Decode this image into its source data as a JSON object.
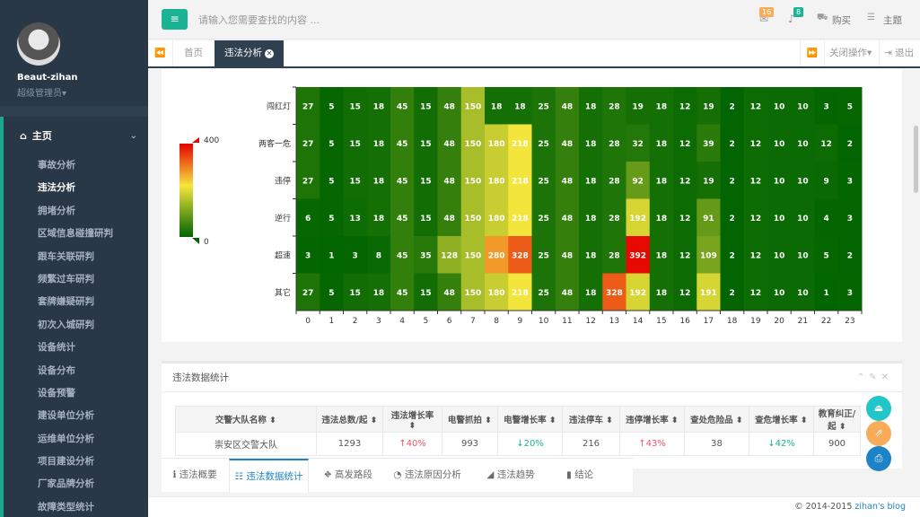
{
  "sidebar": {
    "user_name": "Beaut-zihan",
    "user_role": "超级管理员",
    "menu_title": "主页",
    "items": [
      {
        "label": "事故分析"
      },
      {
        "label": "违法分析",
        "active": true
      },
      {
        "label": "拥堵分析"
      },
      {
        "label": "区域信息碰撞研判"
      },
      {
        "label": "跟车关联研判"
      },
      {
        "label": "频繁过车研判"
      },
      {
        "label": "套牌嫌疑研判"
      },
      {
        "label": "初次入城研判"
      },
      {
        "label": "设备统计"
      },
      {
        "label": "设备分布"
      },
      {
        "label": "设备预警"
      },
      {
        "label": "建设单位分析"
      },
      {
        "label": "运维单位分析"
      },
      {
        "label": "项目建设分析"
      },
      {
        "label": "厂家品牌分析"
      },
      {
        "label": "故障类型统计"
      }
    ]
  },
  "topbar": {
    "search_placeholder": "请输入您需要查找的内容 ...",
    "mail_count": "16",
    "bell_count": "8",
    "buy_label": "购买",
    "theme_label": "主题",
    "colors": {
      "mail_badge": "#f8ac59",
      "bell_badge": "#1ab394"
    }
  },
  "tabs": {
    "home": "首页",
    "active": "违法分析",
    "close_ops": "关闭操作",
    "logout": "退出"
  },
  "heatmap": {
    "legend_max": "400",
    "legend_min": "0",
    "colors": {
      "low": "#006400",
      "mid": "#f5e63c",
      "high": "#e60000"
    }
  },
  "chart_data": {
    "type": "heatmap",
    "x": [
      "0",
      "1",
      "2",
      "3",
      "4",
      "5",
      "6",
      "7",
      "8",
      "9",
      "10",
      "11",
      "12",
      "13",
      "14",
      "15",
      "16",
      "17",
      "18",
      "19",
      "20",
      "21",
      "22",
      "23"
    ],
    "y": [
      "闯红灯",
      "两客一危",
      "违停",
      "逆行",
      "超速",
      "其它"
    ],
    "values": [
      [
        27,
        5,
        15,
        18,
        45,
        15,
        48,
        150,
        18,
        18,
        25,
        48,
        18,
        28,
        19,
        18,
        12,
        19,
        2,
        12,
        10,
        10,
        3,
        5
      ],
      [
        27,
        5,
        15,
        18,
        45,
        15,
        48,
        150,
        180,
        218,
        25,
        48,
        18,
        28,
        32,
        18,
        12,
        39,
        2,
        12,
        10,
        10,
        12,
        2
      ],
      [
        27,
        5,
        15,
        18,
        45,
        15,
        48,
        150,
        180,
        218,
        25,
        48,
        18,
        28,
        92,
        18,
        12,
        19,
        2,
        12,
        10,
        10,
        9,
        3
      ],
      [
        6,
        5,
        13,
        18,
        45,
        15,
        48,
        150,
        180,
        218,
        25,
        48,
        18,
        28,
        192,
        18,
        12,
        91,
        2,
        12,
        10,
        10,
        4,
        3
      ],
      [
        3,
        1,
        3,
        8,
        45,
        35,
        128,
        150,
        280,
        328,
        25,
        48,
        18,
        28,
        392,
        18,
        12,
        109,
        2,
        12,
        10,
        10,
        5,
        2
      ],
      [
        27,
        5,
        15,
        18,
        45,
        15,
        48,
        150,
        180,
        218,
        25,
        48,
        18,
        328,
        192,
        18,
        12,
        191,
        2,
        12,
        10,
        10,
        1,
        3
      ]
    ],
    "visual_range": [
      0,
      400
    ]
  },
  "stats": {
    "panel_title": "违法数据统计",
    "headers": [
      "交警大队名称",
      "违法总数/起",
      "违法增长率",
      "电警抓拍",
      "电警增长率",
      "违法停车",
      "违停增长率",
      "查处危险品",
      "查危增长率",
      "教育纠正/起"
    ],
    "rows": [
      {
        "name": "崇安区交警大队",
        "total": "1293",
        "rate1": "40%",
        "rate1_dir": "up",
        "capture": "993",
        "rate2": "20%",
        "rate2_dir": "down",
        "parking": "216",
        "rate3": "43%",
        "rate3_dir": "up",
        "hazard": "38",
        "rate4": "42%",
        "rate4_dir": "down",
        "educate": "900"
      }
    ]
  },
  "bottom_tabs": [
    {
      "label": "违法概要",
      "icon": "info-icon"
    },
    {
      "label": "违法数据统计",
      "icon": "list-icon",
      "active": true
    },
    {
      "label": "高发路段",
      "icon": "road-icon"
    },
    {
      "label": "违法原因分析",
      "icon": "pie-icon"
    },
    {
      "label": "违法趋势",
      "icon": "area-chart-icon"
    },
    {
      "label": "结论",
      "icon": "book-icon"
    }
  ],
  "footer": {
    "copyright": "© 2014-2015",
    "site": "zihan's blog"
  },
  "float_buttons": {
    "colors": [
      "#23c6c8",
      "#f8ac59",
      "#1c84c6"
    ]
  }
}
